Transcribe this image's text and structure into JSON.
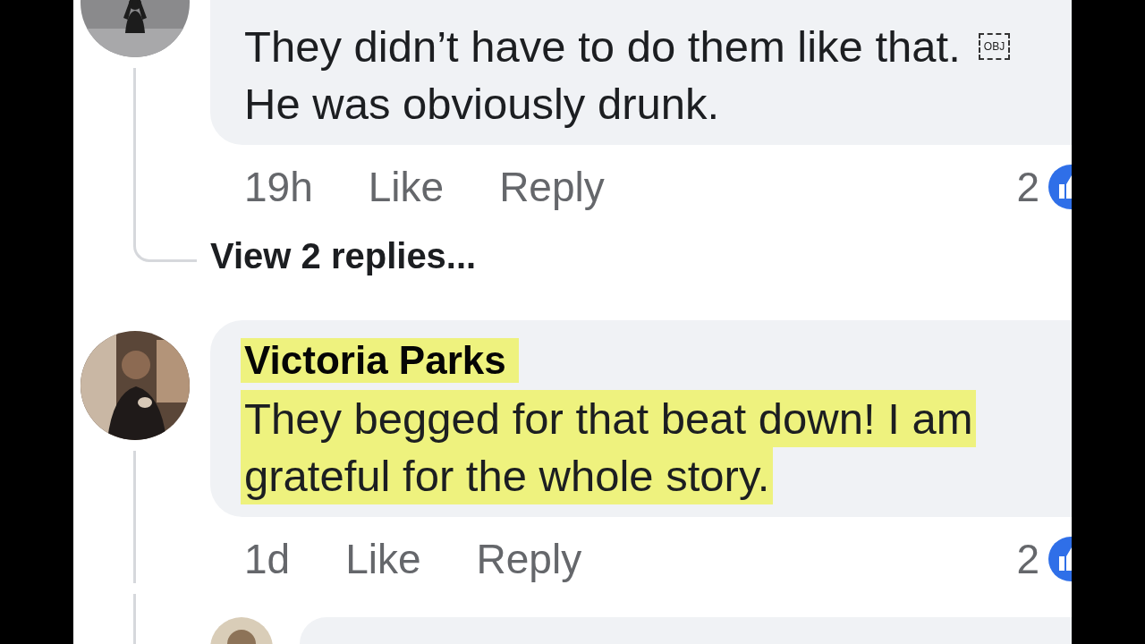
{
  "comments": [
    {
      "text_lines": [
        "They didn’t have to do them like that.",
        "He was obviously drunk."
      ],
      "object_marker": "OBJ",
      "highlighted": false,
      "time": "19h",
      "like_label": "Like",
      "reply_label": "Reply",
      "reaction_count": "2",
      "view_replies": "View 2 replies..."
    },
    {
      "author": "Victoria Parks",
      "text_lines": [
        "They begged for that beat down! I am",
        "grateful for the whole story."
      ],
      "highlighted": true,
      "time": "1d",
      "like_label": "Like",
      "reply_label": "Reply",
      "reaction_count": "2"
    }
  ]
}
